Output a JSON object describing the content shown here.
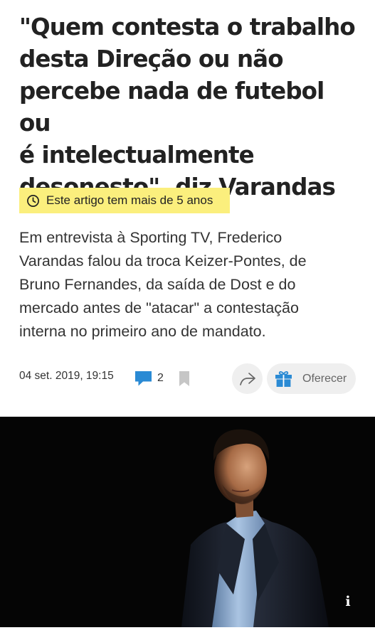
{
  "article": {
    "headline_lines": [
      "\"Quem contesta o trabalho",
      "desta Direção ou não",
      "percebe nada de futebol ou",
      "é intelectualmente",
      "desonesto\", diz Varandas"
    ],
    "age_notice": "Este artigo tem mais de 5 anos",
    "lead_lines": [
      "Em entrevista à Sporting TV, Frederico",
      "Varandas falou da troca Keizer-Pontes, de",
      "Bruno Fernandes, da saída de Dost e do",
      "mercado antes de \"atacar\" a contestação",
      "interna no primeiro ano de mandato."
    ],
    "meta": {
      "date": "04 set. 2019, 19:15",
      "comment_count": "2"
    },
    "actions": {
      "offer_label": "Oferecer",
      "info_label": "i"
    }
  },
  "icons": {
    "age": "clock-icon",
    "comments": "comment-bubble-icon",
    "bookmark": "bookmark-icon",
    "share": "share-arrow-icon",
    "offer": "gift-icon",
    "photo_info": "info-icon"
  },
  "colors": {
    "badge_background": "#fbef7d",
    "comment_icon": "#2a8ad4",
    "gift_icon": "#2a8ad4",
    "bookmark_icon": "#c6c6c6",
    "button_background": "#efefef",
    "photo_background": "#050505"
  }
}
